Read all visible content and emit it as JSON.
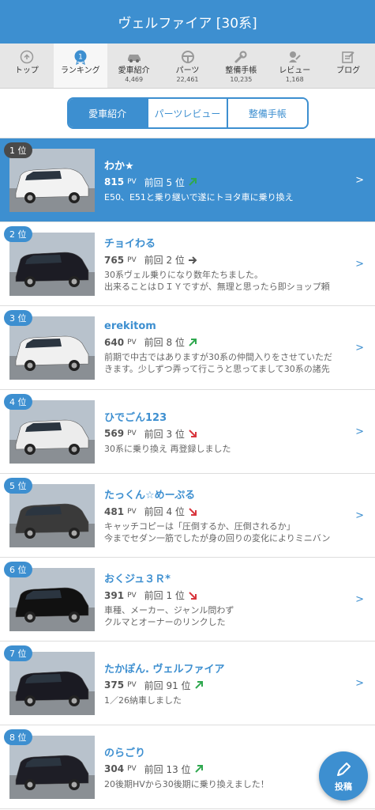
{
  "header": {
    "title": "ヴェルファイア [30系]"
  },
  "tabs": [
    {
      "label": "トップ",
      "count": "",
      "icon": "top-icon"
    },
    {
      "label": "ランキング",
      "count": "",
      "icon": "ranking-medal-icon",
      "badge": "1"
    },
    {
      "label": "愛車紹介",
      "count": "4,469",
      "icon": "car-icon"
    },
    {
      "label": "パーツ",
      "count": "22,461",
      "icon": "steering-wheel-icon"
    },
    {
      "label": "整備手帳",
      "count": "10,235",
      "icon": "wrench-icon"
    },
    {
      "label": "レビュー",
      "count": "1,168",
      "icon": "review-icon"
    },
    {
      "label": "ブログ",
      "count": "",
      "icon": "blog-icon"
    }
  ],
  "segments": [
    "愛車紹介",
    "パーツレビュー",
    "整備手帳"
  ],
  "ranking": [
    {
      "rank": "1 位",
      "name": "わか★",
      "pv": "815",
      "pv_unit": "PV",
      "prev": "前回 5 位",
      "trend": "up",
      "desc1": "E50、E51と乗り継いで遂にトヨタ車に乗り換え",
      "desc2": "",
      "car_color": "#f2f2f2"
    },
    {
      "rank": "2 位",
      "name": "チョイわる",
      "pv": "765",
      "pv_unit": "PV",
      "prev": "前回 2 位",
      "trend": "same",
      "desc1": "30系ヴェル乗りになり数年たちました。",
      "desc2": "出来ることはＤＩＹですが、無理と思ったら即ショップ頼",
      "car_color": "#1c1c24"
    },
    {
      "rank": "3 位",
      "name": "erekitom",
      "pv": "640",
      "pv_unit": "PV",
      "prev": "前回 8 位",
      "trend": "up",
      "desc1": "前期で中古ではありますが30系の仲間入りをさせていただ",
      "desc2": "きます。少しずつ弄って行こうと思ってまして30系の諸先",
      "car_color": "#f0f0f0"
    },
    {
      "rank": "4 位",
      "name": "ひでごん123",
      "pv": "569",
      "pv_unit": "PV",
      "prev": "前回 3 位",
      "trend": "down",
      "desc1": "30系に乗り換え 再登録しました",
      "desc2": "",
      "car_color": "#ececec"
    },
    {
      "rank": "5 位",
      "name": "たっくん☆めーぷる",
      "pv": "481",
      "pv_unit": "PV",
      "prev": "前回 4 位",
      "trend": "down",
      "desc1": "キャッチコピーは「圧倒するか、圧倒されるか」",
      "desc2": "今までセダン一筋でしたが身の回りの変化によりミニバン",
      "car_color": "#3a3a3a"
    },
    {
      "rank": "6 位",
      "name": "おくジュ３Ｒ*",
      "pv": "391",
      "pv_unit": "PV",
      "prev": "前回 1 位",
      "trend": "down",
      "desc1": "車種、メーカー、ジャンル問わず",
      "desc2": "クルマとオーナーのリンクした",
      "car_color": "#111111"
    },
    {
      "rank": "7 位",
      "name": "たかぽん. ヴェルファイア",
      "pv": "375",
      "pv_unit": "PV",
      "prev": "前回 91 位",
      "trend": "up",
      "desc1": "1／26納車しました",
      "desc2": "",
      "car_color": "#1a1a22"
    },
    {
      "rank": "8 位",
      "name": "のらごり",
      "pv": "304",
      "pv_unit": "PV",
      "prev": "前回 13 位",
      "trend": "up",
      "desc1": "20後期HVから30後期に乗り換えました！",
      "desc2": "",
      "car_color": "#1e1e26"
    }
  ],
  "fab": {
    "label": "投稿",
    "icon": "pen-icon"
  },
  "colors": {
    "accent": "#3d8fd0",
    "up": "#2fa84f",
    "down": "#d9363e",
    "same": "#555555"
  }
}
